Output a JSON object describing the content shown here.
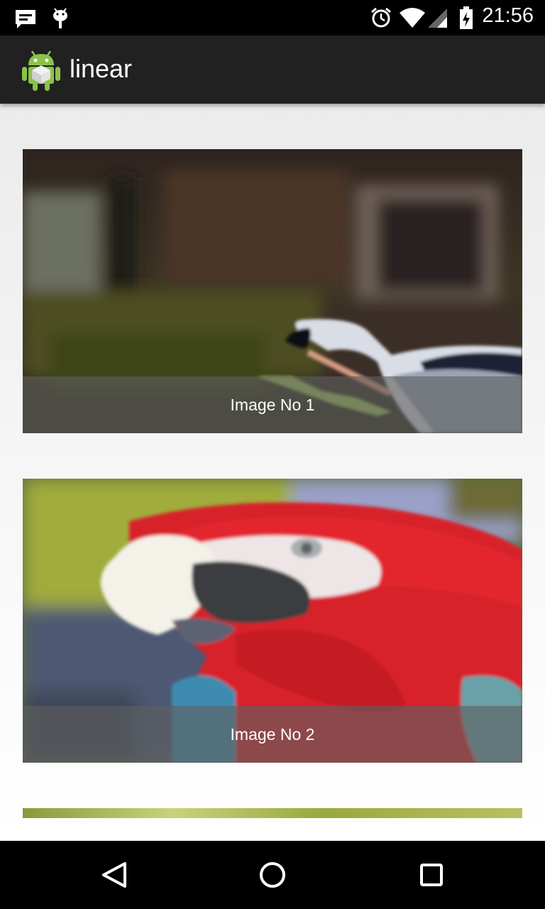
{
  "status_bar": {
    "time": "21:56",
    "icons": [
      "message-icon",
      "android-debug-icon",
      "alarm-icon",
      "wifi-icon",
      "signal-icon",
      "battery-charging-icon"
    ]
  },
  "action_bar": {
    "title": "linear",
    "icon": "android-app-icon"
  },
  "list": {
    "items": [
      {
        "caption": "Image No 1",
        "image": "heron-photo"
      },
      {
        "caption": "Image No 2",
        "image": "parrot-photo"
      }
    ]
  },
  "nav_bar": {
    "buttons": [
      "back-icon",
      "home-icon",
      "recents-icon"
    ]
  }
}
